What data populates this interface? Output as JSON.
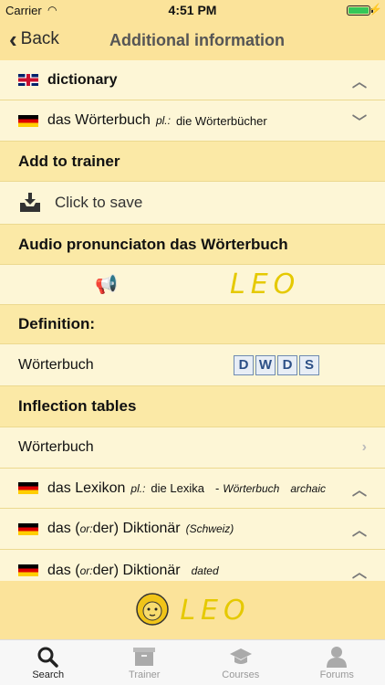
{
  "status": {
    "carrier": "Carrier",
    "time": "4:51 PM"
  },
  "nav": {
    "back_label": "Back",
    "title": "Additional information"
  },
  "entries": {
    "en_word": "dictionary",
    "de_word": "das Wörterbuch",
    "de_pl_label": "pl.:",
    "de_pl_value": "die Wörterbücher"
  },
  "trainer": {
    "header": "Add to trainer",
    "save_label": "Click to save"
  },
  "audio": {
    "header": "Audio pronunciaton das Wörterbuch",
    "logo_text": "LEO"
  },
  "definition": {
    "header": "Definition:",
    "word": "Wörterbuch",
    "source_letters": [
      "D",
      "W",
      "D",
      "S"
    ]
  },
  "inflection": {
    "header": "Inflection tables",
    "word": "Wörterbuch"
  },
  "related": [
    {
      "text": "das Lexikon",
      "pl_label": "pl.:",
      "pl_value": "die Lexika",
      "dash": "-",
      "ref": "Wörterbuch",
      "note": "archaic"
    },
    {
      "text_a": "das (",
      "or_label": "or:",
      "text_b": " der) Diktionär",
      "note": "(Schweiz)"
    },
    {
      "text_a": "das (",
      "or_label": "or:",
      "text_b": " der) Diktionär",
      "note": "dated"
    }
  ],
  "footer_logo": "LEO",
  "tabs": [
    {
      "label": "Search",
      "icon": "search-icon"
    },
    {
      "label": "Trainer",
      "icon": "box-icon"
    },
    {
      "label": "Courses",
      "icon": "graduation-cap-icon"
    },
    {
      "label": "Forums",
      "icon": "person-icon"
    }
  ]
}
